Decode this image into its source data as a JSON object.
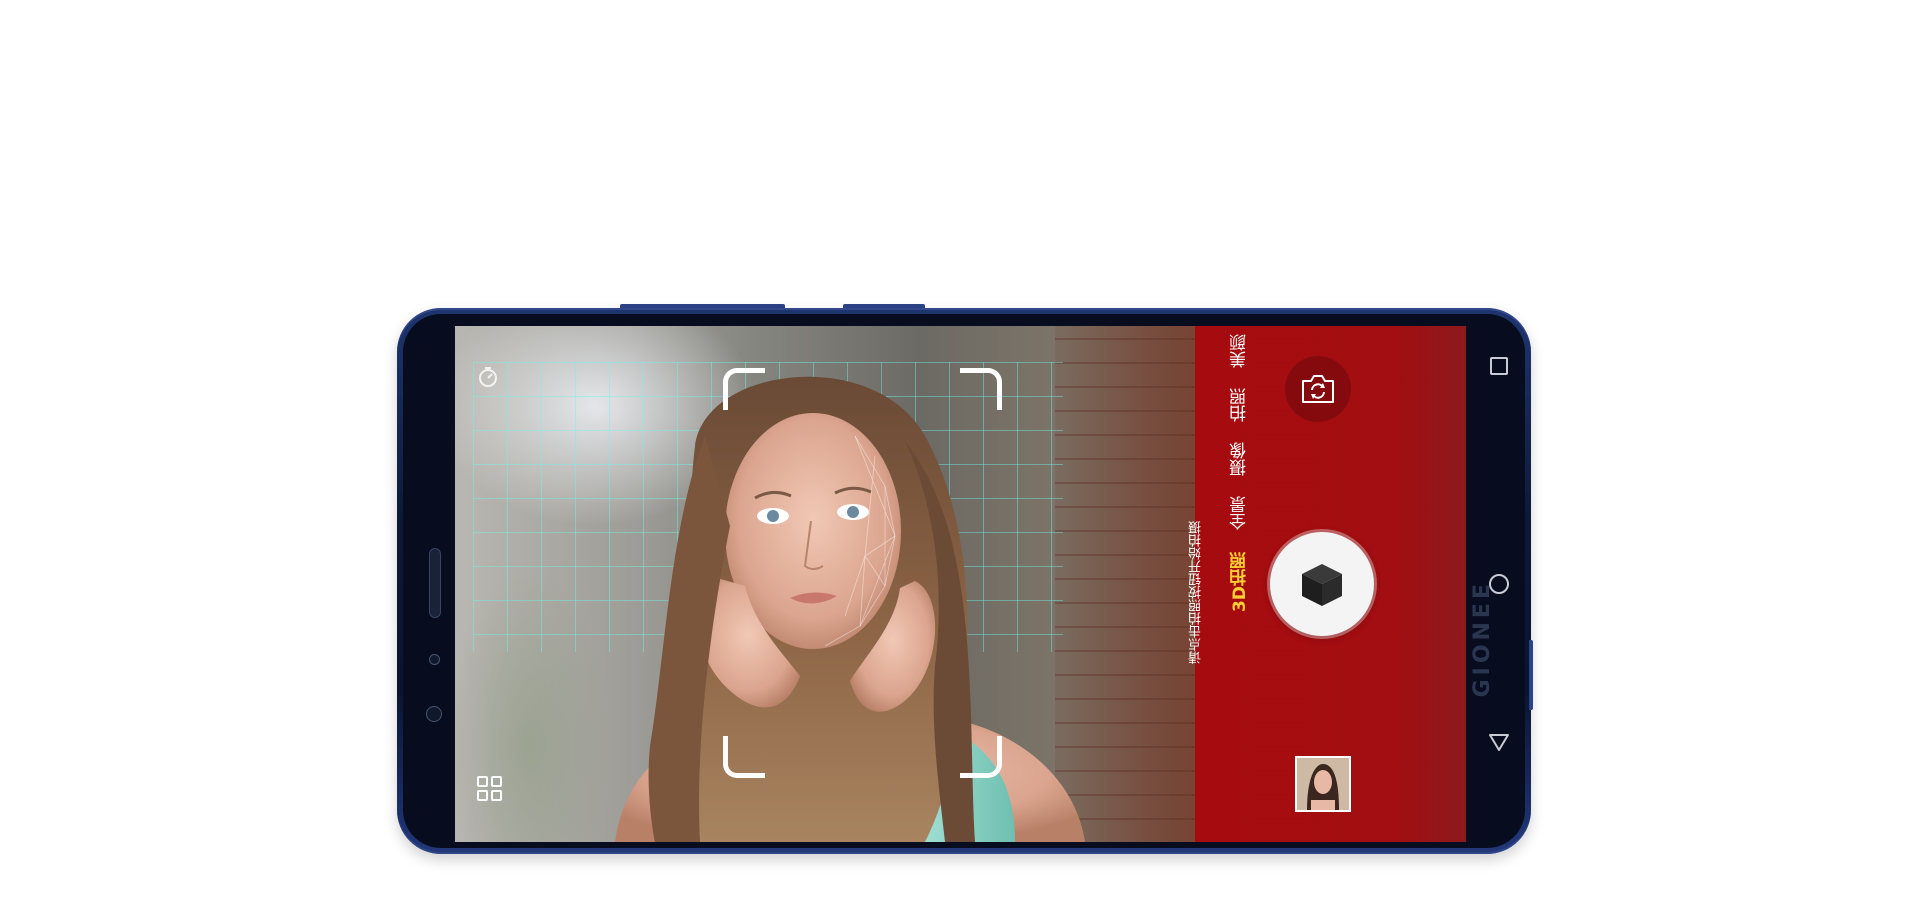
{
  "brand": "GIONEE",
  "camera": {
    "hint_text": "请点击拍照按钮开始拍摄",
    "modes": [
      {
        "label": "美颜",
        "active": false
      },
      {
        "label": "拍照",
        "active": false
      },
      {
        "label": "摄像",
        "active": false
      },
      {
        "label": "全景",
        "active": false
      },
      {
        "label": "3D拍照",
        "active": true
      }
    ],
    "active_color": "#ffcf33",
    "panel_color": "#aa080c",
    "grid_color": "#6ef5eb"
  },
  "icons": {
    "switch_camera": "camera-switch-icon",
    "shutter": "cube-icon",
    "timer": "timer-icon",
    "gallery": "grid-icon",
    "recents": "square-icon",
    "home": "circle-icon",
    "back": "triangle-icon"
  }
}
